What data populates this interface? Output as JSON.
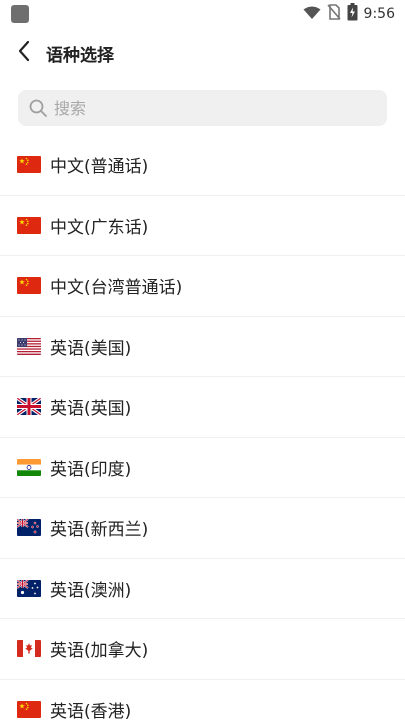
{
  "status": {
    "time": "9:56",
    "icons": [
      "app-square-icon",
      "wifi-icon",
      "no-sim-icon",
      "battery-charging-icon"
    ]
  },
  "header": {
    "back_icon": "chevron-left-icon",
    "title": "语种选择"
  },
  "search": {
    "icon": "search-icon",
    "placeholder": "搜索",
    "value": ""
  },
  "languages": [
    {
      "label": "中文(普通话)",
      "flag": "cn-flag-icon"
    },
    {
      "label": "中文(广东话)",
      "flag": "cn-flag-icon"
    },
    {
      "label": "中文(台湾普通话)",
      "flag": "cn-flag-icon"
    },
    {
      "label": "英语(美国)",
      "flag": "us-flag-icon"
    },
    {
      "label": "英语(英国)",
      "flag": "uk-flag-icon"
    },
    {
      "label": "英语(印度)",
      "flag": "in-flag-icon"
    },
    {
      "label": "英语(新西兰)",
      "flag": "nz-flag-icon"
    },
    {
      "label": "英语(澳洲)",
      "flag": "au-flag-icon"
    },
    {
      "label": "英语(加拿大)",
      "flag": "ca-flag-icon"
    },
    {
      "label": "英语(香港)",
      "flag": "cn-flag-icon"
    }
  ]
}
